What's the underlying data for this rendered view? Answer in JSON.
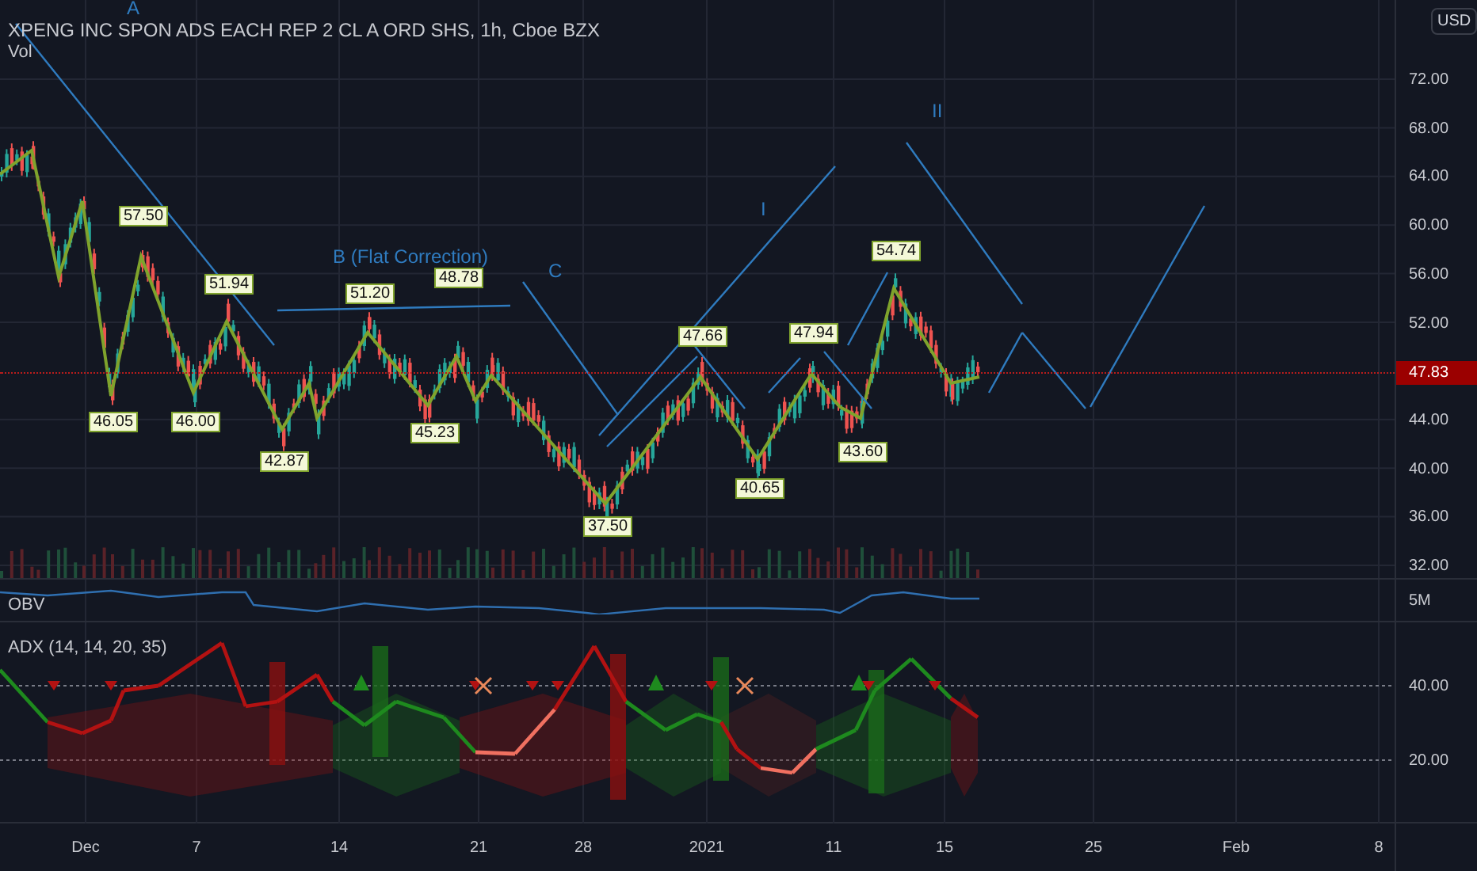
{
  "chart": {
    "title": "XPENG INC SPON ADS EACH REP 2 CL A ORD SHS, 1h, Cboe BZX",
    "volume_label": "Vol",
    "currency": "USD",
    "wave_labels": [
      "A",
      "B (Flat Correction)",
      "C",
      "I",
      "II"
    ],
    "pivot_labels": [
      {
        "text": "57.50",
        "kind": "high"
      },
      {
        "text": "51.94",
        "kind": "high"
      },
      {
        "text": "46.05",
        "kind": "low"
      },
      {
        "text": "46.00",
        "kind": "low"
      },
      {
        "text": "42.87",
        "kind": "low"
      },
      {
        "text": "51.20",
        "kind": "high"
      },
      {
        "text": "48.78",
        "kind": "high"
      },
      {
        "text": "45.23",
        "kind": "low"
      },
      {
        "text": "37.50",
        "kind": "low"
      },
      {
        "text": "47.66",
        "kind": "high"
      },
      {
        "text": "40.65",
        "kind": "low"
      },
      {
        "text": "47.94",
        "kind": "high"
      },
      {
        "text": "43.60",
        "kind": "low"
      },
      {
        "text": "54.74",
        "kind": "high"
      }
    ],
    "price_ticks": [
      "72.00",
      "68.00",
      "64.00",
      "60.00",
      "56.00",
      "52.00",
      "44.00",
      "40.00",
      "36.00",
      "32.00"
    ],
    "last_price": "47.83"
  },
  "obv": {
    "label": "OBV",
    "scale": "5M"
  },
  "adx": {
    "label": "ADX (14, 14, 20, 35)",
    "ticks": [
      "40.00",
      "20.00"
    ]
  },
  "time_axis": [
    "Dec",
    "7",
    "14",
    "21",
    "28",
    "2021",
    "11",
    "15",
    "25",
    "Feb",
    "8"
  ]
}
